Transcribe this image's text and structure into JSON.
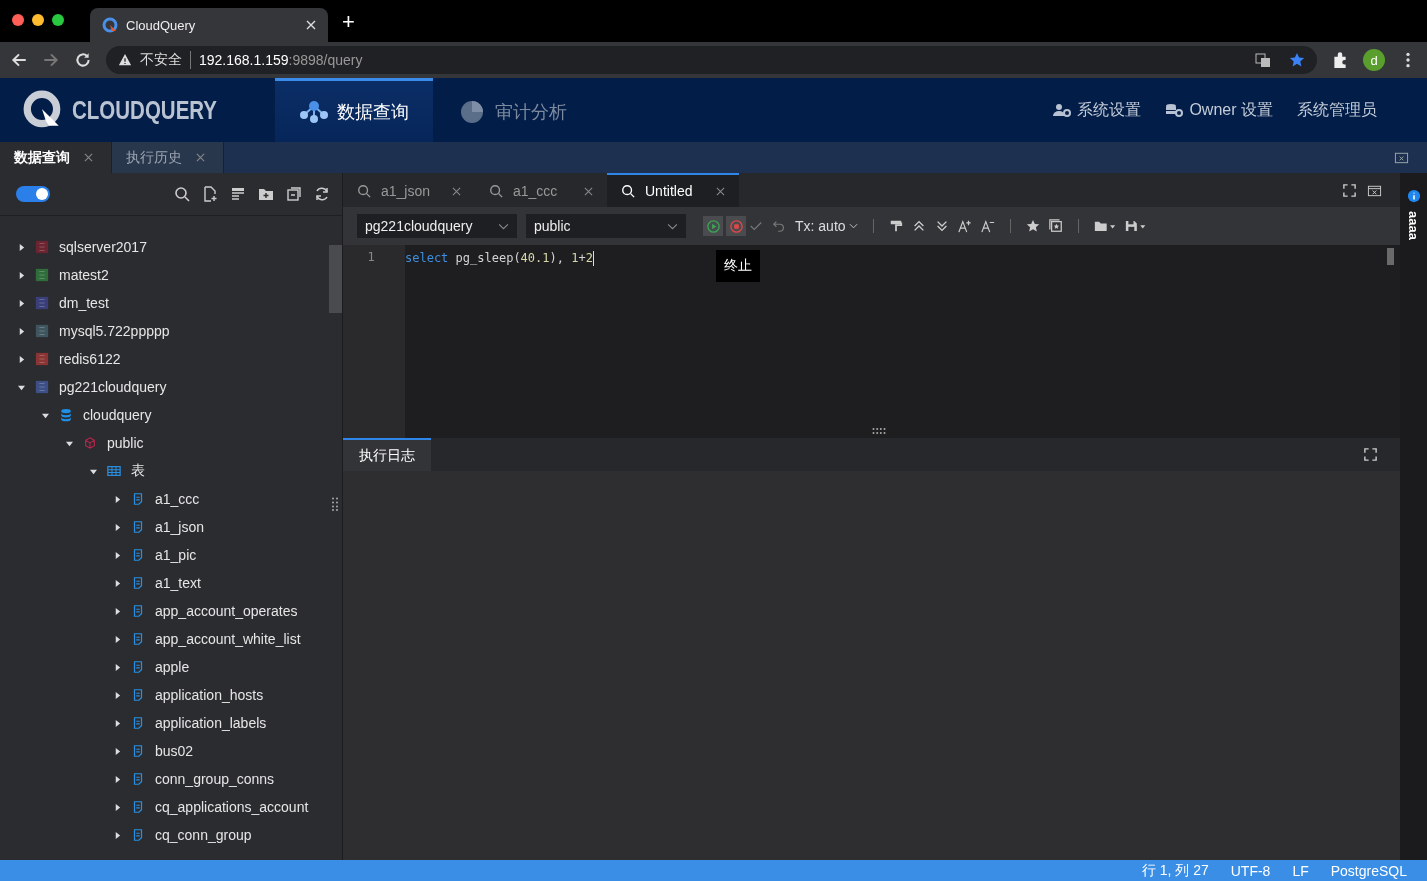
{
  "browser": {
    "tab_title": "CloudQuery",
    "new_tab": "+",
    "security": "不安全",
    "url_host": "192.168.1.159",
    "url_path": ":9898/query",
    "profile_initial": "d"
  },
  "header": {
    "logo": "CLOUDQUERY",
    "nav": [
      {
        "label": "数据查询",
        "selected": true
      },
      {
        "label": "审计分析",
        "selected": false
      }
    ],
    "actions": [
      {
        "label": "系统设置",
        "kind": "user"
      },
      {
        "label": "Owner 设置",
        "kind": "db"
      },
      {
        "label": "系统管理员",
        "kind": "plain"
      }
    ]
  },
  "page_tabs": [
    {
      "label": "数据查询",
      "selected": true
    },
    {
      "label": "执行历史",
      "selected": false
    }
  ],
  "sidebar": {
    "theme_toggle": {
      "on": true
    },
    "tree": [
      {
        "name": "sqlserver2017",
        "kind": "sqlserver",
        "expanded": false
      },
      {
        "name": "matest2",
        "kind": "mongodb",
        "expanded": false
      },
      {
        "name": "dm_test",
        "kind": "dm",
        "expanded": false
      },
      {
        "name": "mysql5.722ppppp",
        "kind": "mysql",
        "expanded": false
      },
      {
        "name": "redis6122",
        "kind": "redis",
        "expanded": false
      },
      {
        "name": "pg221cloudquery",
        "kind": "postgres",
        "expanded": true,
        "children": [
          {
            "name": "cloudquery",
            "kind": "database",
            "expanded": true,
            "children": [
              {
                "name": "public",
                "kind": "schema",
                "expanded": true,
                "children": [
                  {
                    "name": "表",
                    "kind": "tables",
                    "expanded": true,
                    "children": [
                      {
                        "name": "a1_ccc",
                        "kind": "table",
                        "expanded": false
                      },
                      {
                        "name": "a1_json",
                        "kind": "table",
                        "expanded": false
                      },
                      {
                        "name": "a1_pic",
                        "kind": "table",
                        "expanded": false
                      },
                      {
                        "name": "a1_text",
                        "kind": "table",
                        "expanded": false
                      },
                      {
                        "name": "app_account_operates",
                        "kind": "table",
                        "expanded": false
                      },
                      {
                        "name": "app_account_white_list",
                        "kind": "table",
                        "expanded": false
                      },
                      {
                        "name": "apple",
                        "kind": "table",
                        "expanded": false
                      },
                      {
                        "name": "application_hosts",
                        "kind": "table",
                        "expanded": false
                      },
                      {
                        "name": "application_labels",
                        "kind": "table",
                        "expanded": false
                      },
                      {
                        "name": "bus02",
                        "kind": "table",
                        "expanded": false
                      },
                      {
                        "name": "conn_group_conns",
                        "kind": "table",
                        "expanded": false
                      },
                      {
                        "name": "cq_applications_account",
                        "kind": "table",
                        "expanded": false
                      },
                      {
                        "name": "cq_conn_group",
                        "kind": "table",
                        "expanded": false
                      }
                    ]
                  }
                ]
              }
            ]
          }
        ]
      }
    ]
  },
  "editor_tabs": [
    {
      "label": "a1_json",
      "selected": false
    },
    {
      "label": "a1_ccc",
      "selected": false
    },
    {
      "label": "Untitled",
      "selected": true
    }
  ],
  "toolbar": {
    "connection": "pg221cloudquery",
    "schema": "public",
    "tx": "Tx: auto",
    "tooltip": "终止"
  },
  "editor": {
    "lines": [
      {
        "number": "1",
        "tokens": [
          {
            "text": "select",
            "kind": "keyword"
          },
          {
            "text": " pg_sleep(",
            "kind": "plain"
          },
          {
            "text": "40.1",
            "kind": "number"
          },
          {
            "text": "), ",
            "kind": "plain"
          },
          {
            "text": "1",
            "kind": "number"
          },
          {
            "text": "+",
            "kind": "plain"
          },
          {
            "text": "2",
            "kind": "number"
          }
        ]
      }
    ]
  },
  "log_panel": {
    "tab": "执行日志"
  },
  "right_rail": {
    "label": "aaaa"
  },
  "status_bar": [
    "行 1, 列 27",
    "UTF-8",
    "LF",
    "PostgreSQL"
  ]
}
